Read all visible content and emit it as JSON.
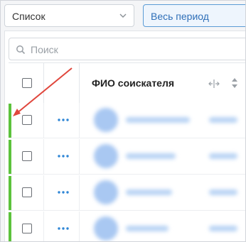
{
  "filters": {
    "view_select": {
      "value": "Список"
    },
    "period_select": {
      "value": "Весь период"
    }
  },
  "search": {
    "placeholder": "Поиск"
  },
  "table": {
    "column_header": "ФИО соискателя",
    "row_menu_label": "···",
    "rows_visible": 4,
    "status_color": "#5cc23c"
  },
  "colors": {
    "accent_blue": "#2f6fb8",
    "annotation_red": "#e0463c"
  }
}
